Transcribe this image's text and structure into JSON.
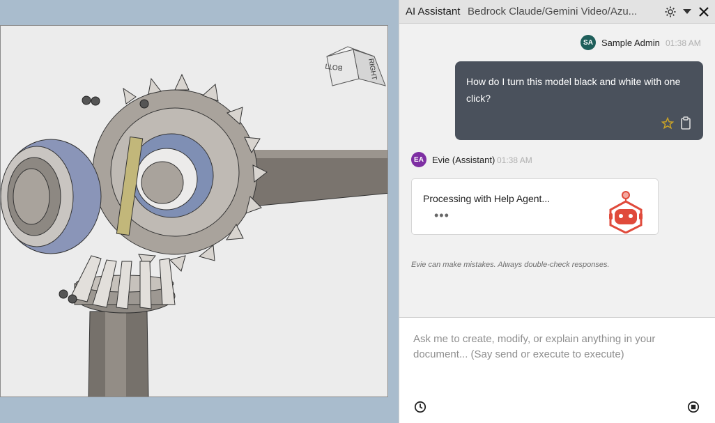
{
  "panel": {
    "title": "AI Assistant",
    "model": "Bedrock Claude/Gemini Video/Azu..."
  },
  "viewcube": {
    "face_top": "BOTTOM",
    "face_right": "RIGHT"
  },
  "messages": {
    "user": {
      "initials": "SA",
      "name": "Sample Admin",
      "time": "01:38 AM",
      "text": "How do I turn this model black and white with one click?",
      "avatar_color": "#1f5f5b"
    },
    "assistant": {
      "initials": "EA",
      "name": "Evie (Assistant)",
      "time": "01:38 AM",
      "processing_text": "Processing with Help Agent...",
      "dots": "•••",
      "avatar_color": "#7e2fa3"
    }
  },
  "disclaimer": "Evie can make mistakes. Always double-check responses.",
  "input": {
    "placeholder": "Ask me to create, modify, or explain anything in your document... (Say send or execute to execute)"
  },
  "colors": {
    "accent_star": "#c9a227",
    "agent_red": "#e04a3b"
  },
  "icons": [
    "gear-icon",
    "chevron-down-icon",
    "close-icon",
    "star-icon",
    "clipboard-icon",
    "help-agent-robot-icon",
    "history-clock-icon",
    "stop-icon"
  ]
}
